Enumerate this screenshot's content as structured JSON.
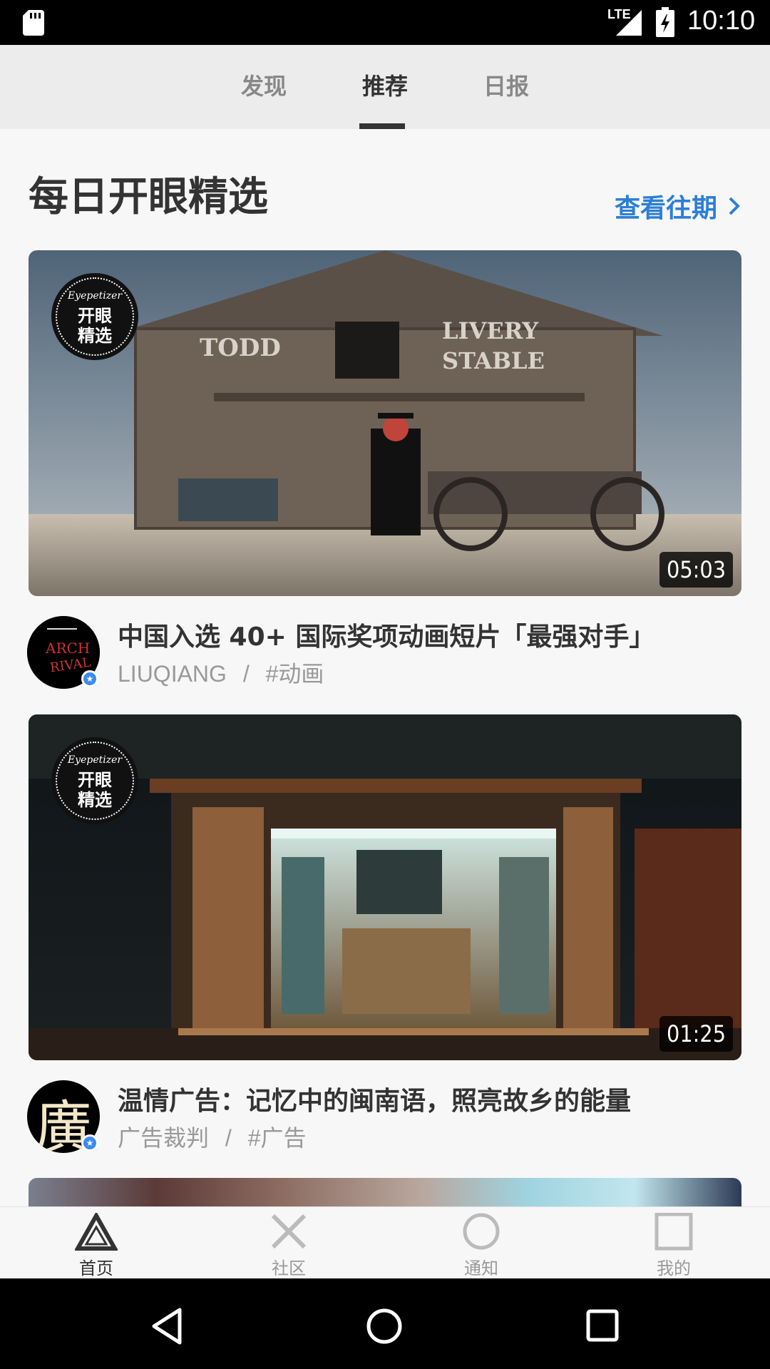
{
  "status_bar": {
    "network": "LTE",
    "time": "10:10"
  },
  "top_tabs": [
    {
      "label": "发现",
      "active": false
    },
    {
      "label": "推荐",
      "active": true
    },
    {
      "label": "日报",
      "active": false
    }
  ],
  "section": {
    "title": "每日开眼精选",
    "history_link": "查看往期"
  },
  "badge": {
    "brand": "Eyepetizer",
    "label": "开眼精选"
  },
  "videos": [
    {
      "duration": "05:03",
      "title": "中国入选 40+ 国际奖项动画短片「最强对手」",
      "author": "LIUQIANG",
      "separator": "/",
      "tag": "#动画",
      "avatar_text": "ARCH RIVAL",
      "thumb_sign_left": "TODD",
      "thumb_sign_right": "LIVERY STABLE"
    },
    {
      "duration": "01:25",
      "title": "温情广告：记忆中的闽南语，照亮故乡的能量",
      "author": "广告裁判",
      "separator": "/",
      "tag": "#广告",
      "avatar_text": "廣"
    }
  ],
  "bottom_nav": [
    {
      "label": "首页",
      "icon": "triangle-icon",
      "active": true
    },
    {
      "label": "社区",
      "icon": "cross-icon",
      "active": false
    },
    {
      "label": "通知",
      "icon": "circle-icon",
      "active": false
    },
    {
      "label": "我的",
      "icon": "square-icon",
      "active": false
    }
  ],
  "colors": {
    "accent": "#2c7fd8",
    "status_bar": "#000000",
    "tab_bar": "#ececec"
  }
}
